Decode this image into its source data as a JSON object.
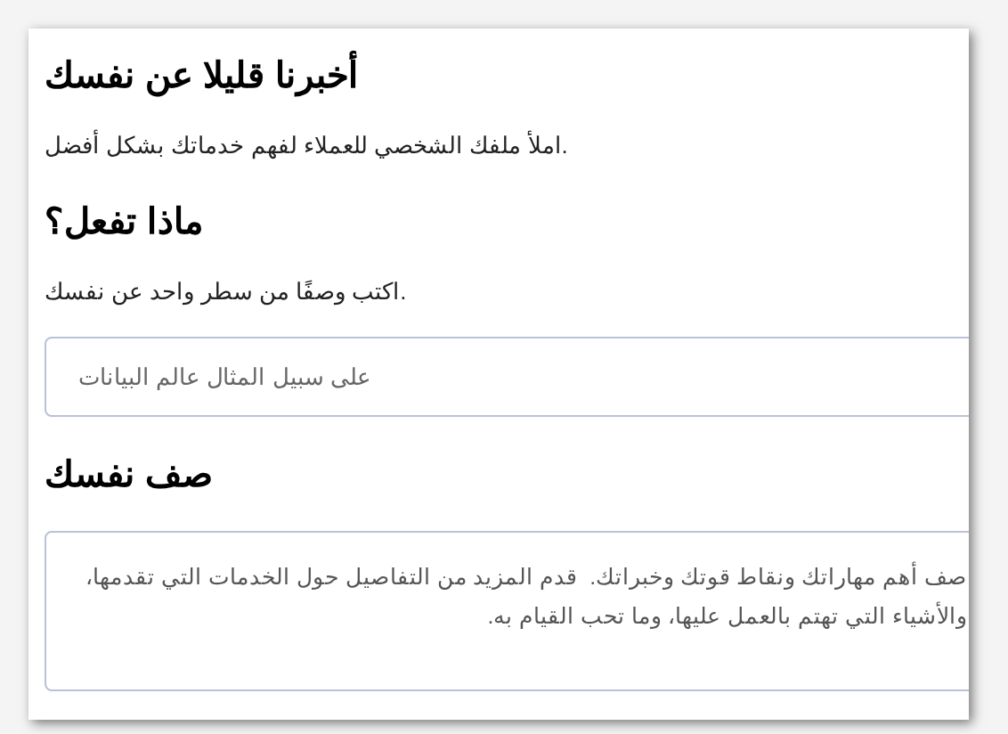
{
  "sections": [
    {
      "heading": "أخبرنا قليلا عن نفسك",
      "description": "املأ ملفك الشخصي للعملاء لفهم خدماتك بشكل أفضل."
    },
    {
      "heading": "ماذا تفعل؟",
      "description": "اكتب وصفًا من سطر واحد عن نفسك.",
      "field": {
        "kind": "input",
        "placeholder": "على سبيل المثال عالم البيانات"
      }
    },
    {
      "heading": "صف نفسك",
      "field": {
        "kind": "textarea",
        "placeholder": "صف أهم مهاراتك ونقاط قوتك وخبراتك.  قدم المزيد من التفاصيل حول الخدمات التي تقدمها، والأشياء التي تهتم بالعمل عليها، وما تحب القيام به."
      }
    }
  ]
}
